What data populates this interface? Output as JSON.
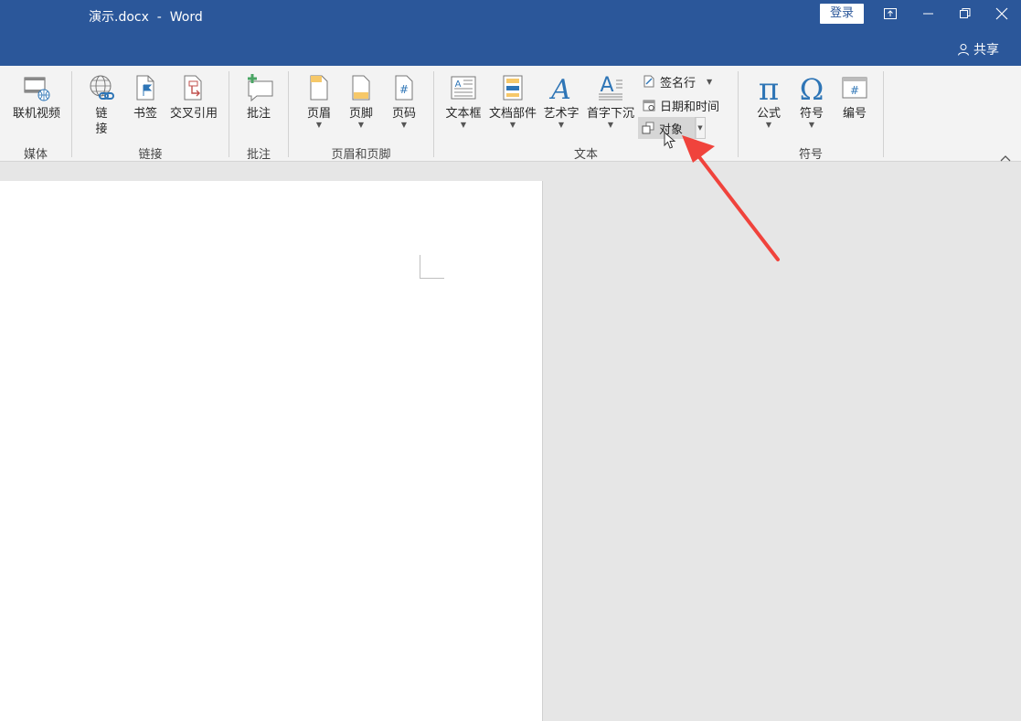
{
  "window": {
    "title": "演示.docx  -  Word",
    "login_label": "登录",
    "share_label": "共享"
  },
  "ribbon": {
    "media": {
      "online_video": "联机视频",
      "group": "媒体"
    },
    "links": {
      "link_line1": "链",
      "link_line2": "接",
      "bookmark": "书签",
      "cross_reference": "交叉引用",
      "group": "链接"
    },
    "comments": {
      "comment": "批注",
      "group": "批注"
    },
    "header_footer": {
      "header": "页眉",
      "footer": "页脚",
      "page_number": "页码",
      "group": "页眉和页脚"
    },
    "text": {
      "text_box": "文本框",
      "quick_parts": "文档部件",
      "wordart": "艺术字",
      "drop_cap": "首字下沉",
      "signature_line": "签名行",
      "date_time": "日期和时间",
      "object": "对象",
      "group": "文本"
    },
    "symbols": {
      "equation": "公式",
      "symbol": "符号",
      "number": "编号",
      "group": "符号"
    }
  },
  "colors": {
    "title_bar": "#2b579a",
    "ribbon": "#f3f3f3",
    "workspace": "#e6e6e6",
    "annotation_arrow": "#f0433c"
  }
}
